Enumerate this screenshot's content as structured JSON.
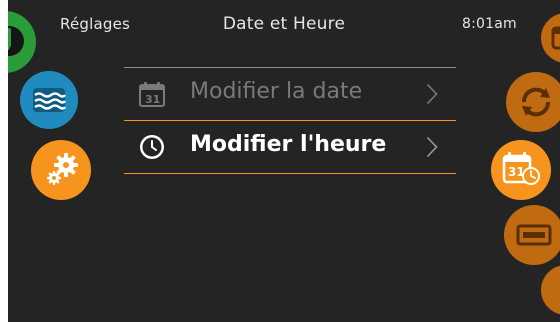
{
  "header": {
    "back_label": "Réglages",
    "title": "Date et Heure",
    "time": "8:01am"
  },
  "menu": {
    "items": [
      {
        "label": "Modifier la date",
        "icon": "calendar-icon",
        "calendar_day": "31",
        "state": "disabled"
      },
      {
        "label": "Modifier l'heure",
        "icon": "clock-icon",
        "state": "selected"
      }
    ]
  },
  "left_nav": {
    "items": [
      {
        "icon": "music-icon",
        "color": "#2a9d3a"
      },
      {
        "icon": "water-waves-icon",
        "color": "#1f8bbf"
      },
      {
        "icon": "gears-icon",
        "color": "#f7941d"
      }
    ]
  },
  "right_nav": {
    "items": [
      {
        "icon": "calendar-icon",
        "color": "#c06a12"
      },
      {
        "icon": "recycle-icon",
        "color": "#c06a12"
      },
      {
        "icon": "calendar-clock-icon",
        "color": "#f7941d",
        "calendar_day": "31",
        "state": "active"
      },
      {
        "icon": "display-icon",
        "color": "#c06a12"
      },
      {
        "icon": "circle-button",
        "color": "#c06a12"
      }
    ]
  },
  "colors": {
    "background": "#242424",
    "accent_orange": "#f7941d",
    "dim_orange": "#c06a12",
    "text": "#e6e6e6",
    "disabled_text": "#7a7a7a",
    "divider": "#8a8a8a"
  }
}
